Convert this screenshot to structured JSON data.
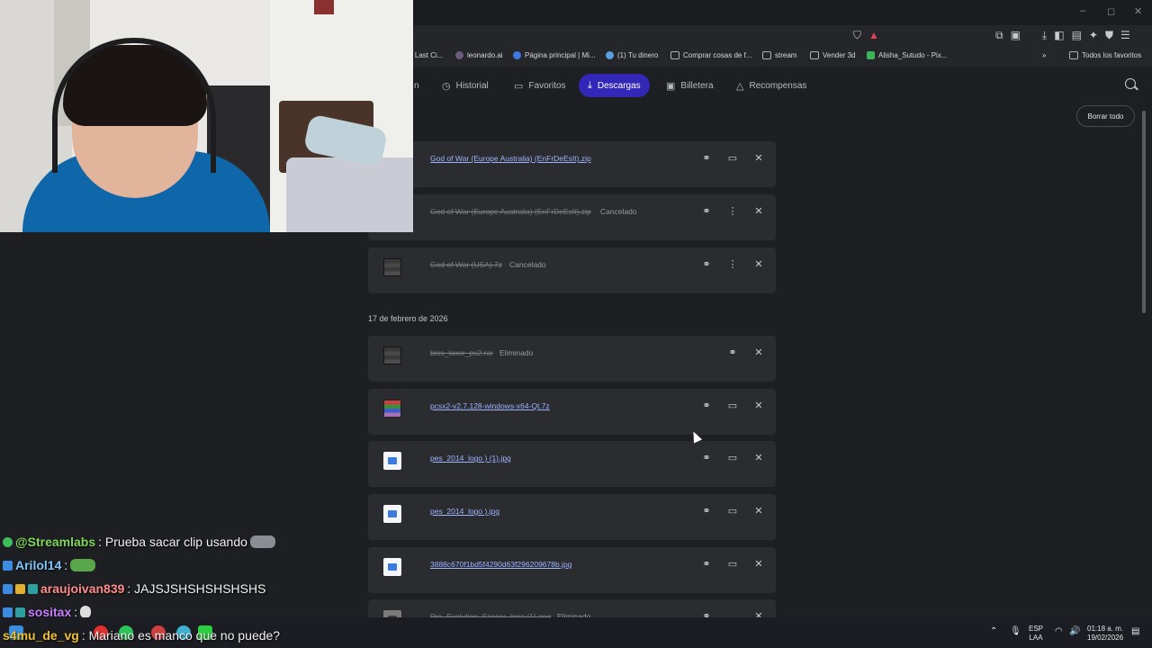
{
  "browser": {
    "bookmarks": [
      {
        "label": "r Last Ci...",
        "icon": "page-icon"
      },
      {
        "label": "leonardo.ai",
        "icon": "leonardo-icon"
      },
      {
        "label": "Página principal | Mi...",
        "icon": "globe-icon"
      },
      {
        "label": "(1) Tu dinero",
        "icon": "cloud-icon"
      },
      {
        "label": "Comprar cosas de f...",
        "icon": "folder-icon"
      },
      {
        "label": "stream",
        "icon": "folder-icon"
      },
      {
        "label": "Vender 3d",
        "icon": "folder-icon"
      },
      {
        "label": "Alisha_Sutudo - Pix...",
        "icon": "pixiv-icon"
      }
    ],
    "all_bookmarks": "Todos los favoritos",
    "window_controls": {
      "minimize": "–",
      "maximize": "◻",
      "close": "✕"
    }
  },
  "nav": {
    "partial_tab": "n",
    "tabs": [
      {
        "label": "Historial",
        "icon": "clock-icon"
      },
      {
        "label": "Favoritos",
        "icon": "bookmark-icon"
      },
      {
        "label": "Descargas",
        "icon": "download-icon",
        "active": true
      },
      {
        "label": "Billetera",
        "icon": "wallet-icon"
      },
      {
        "label": "Recompensas",
        "icon": "triangle-icon"
      }
    ],
    "clear_all": "Borrar todo"
  },
  "downloads": {
    "date_header": "17 de febrero de 2026",
    "items": [
      {
        "name": "God of War (Europe Australia) (EnFrDeEsIt).zip",
        "status": "",
        "state": "done",
        "type": "zip"
      },
      {
        "name": "God of War (Europe Australia) (EnFrDeEsIt).zip",
        "status": "Cancelado",
        "state": "cancel",
        "type": "zip"
      },
      {
        "name": "God of War (USA).7z",
        "status": "Cancelado",
        "state": "cancel",
        "type": "rar"
      },
      {
        "name": "bios_laxor_ps2.rar",
        "status": "Eliminado",
        "state": "cancel",
        "type": "rar"
      },
      {
        "name": "pcsx2-v2.7.128-windows-x64-Qt.7z",
        "status": "",
        "state": "done",
        "type": "rar"
      },
      {
        "name": "pes_2014_logo ) (1).jpg",
        "status": "",
        "state": "done",
        "type": "jpg"
      },
      {
        "name": "pes_2014_logo ).jpg",
        "status": "",
        "state": "done",
        "type": "jpg"
      },
      {
        "name": "3888c670f1bd5f4290d63f296209678b.jpg",
        "status": "",
        "state": "done",
        "type": "jpg"
      },
      {
        "name": "Pro_Evolution_Soccer_logo (1).png",
        "status": "Eliminado",
        "state": "cancel",
        "type": "jpg"
      }
    ]
  },
  "chat": [
    {
      "user": "@Streamlabs",
      "color": "#7fd85a",
      "text": ": Prueba sacar clip usando"
    },
    {
      "user": "Arilol14",
      "color": "#7ec4ff",
      "text": ":"
    },
    {
      "user": "araujoivan839",
      "color": "#ff8c8c",
      "text": ": JAJSJSHSHSHSHSHS"
    },
    {
      "user": "sositax",
      "color": "#c77dff",
      "text": ":"
    },
    {
      "user": "s4mu_de_vg",
      "color": "#f0c030",
      "text": ": Mariano es manco que no puede?"
    }
  ],
  "tray": {
    "lang": "ESP",
    "lang2": "LAA",
    "time": "01:18 a. m.",
    "date": "19/02/2026"
  },
  "colors": {
    "accent": "#3327b8",
    "link": "#9fb4ff",
    "card": "#2b2c30"
  }
}
